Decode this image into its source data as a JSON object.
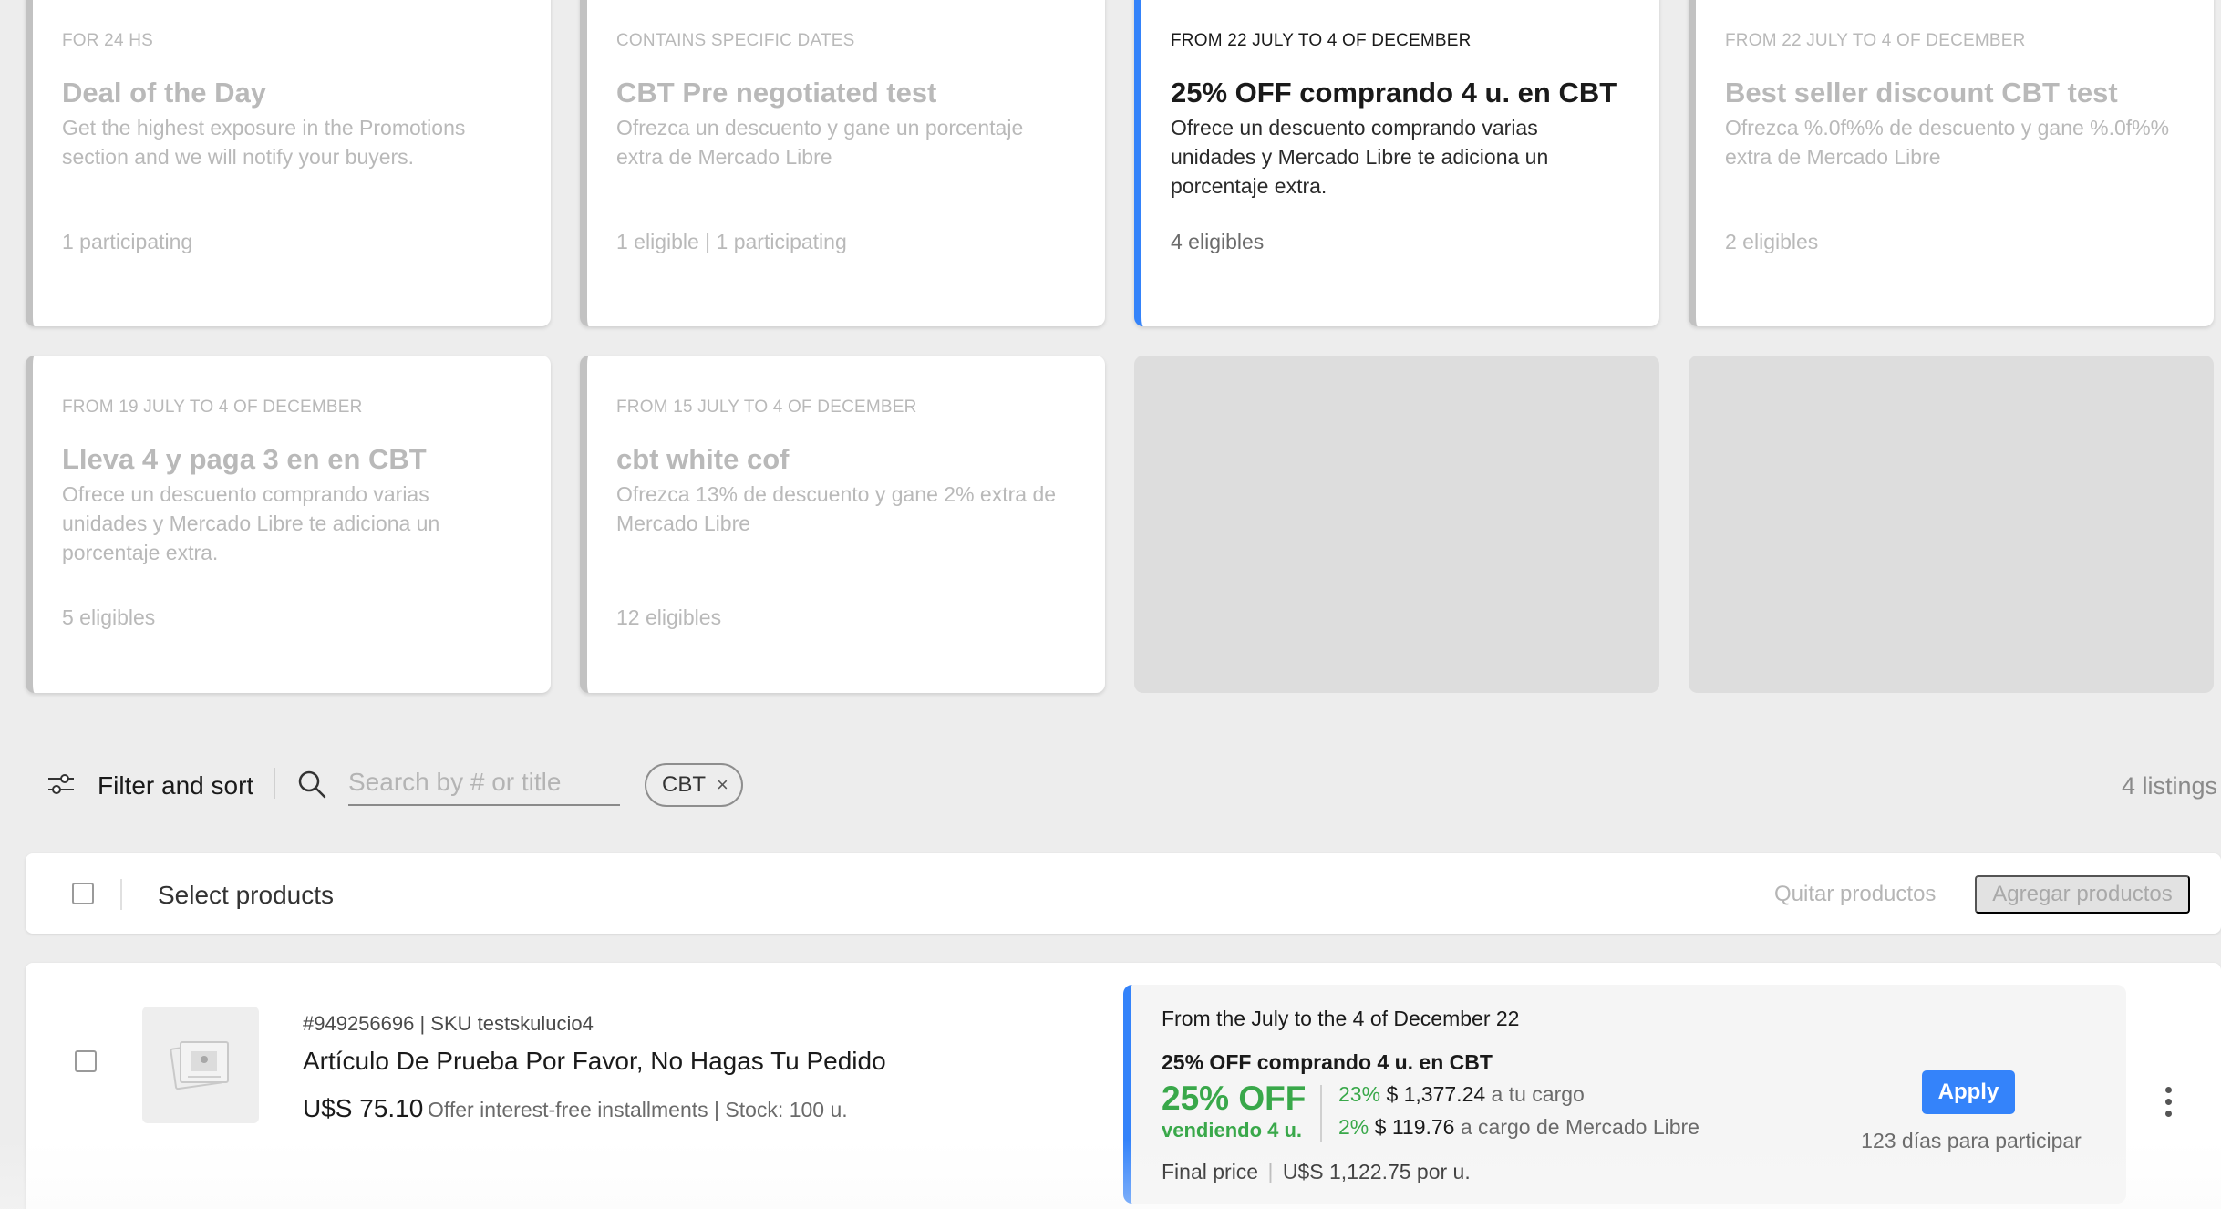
{
  "promotions": [
    {
      "date": "FOR 24 HS",
      "title": "Deal of the Day",
      "desc": "Get the highest exposure in the Promotions section and we will notify your buyers.",
      "count": "1 participating",
      "state": "disabled"
    },
    {
      "date": "CONTAINS SPECIFIC DATES",
      "title": "CBT Pre negotiated test",
      "desc": "Ofrezca un descuento y gane un porcentaje extra de Mercado Libre",
      "count": "1 eligible | 1 participating",
      "state": "disabled"
    },
    {
      "date": "FROM 22 JULY TO 4 OF DECEMBER",
      "title": "25% OFF comprando 4 u. en CBT",
      "desc": "Ofrece un descuento comprando varias unidades y Mercado Libre te adiciona un porcentaje extra.",
      "count": "4 eligibles",
      "state": "active"
    },
    {
      "date": "FROM 22 JULY TO 4 OF DECEMBER",
      "title": "Best seller discount CBT test",
      "desc": "Ofrezca %.0f%% de descuento y gane %.0f%% extra de Mercado Libre",
      "count": "2 eligibles",
      "state": "disabled"
    },
    {
      "date": "FROM 19 JULY TO 4 OF DECEMBER",
      "title": "Lleva 4 y paga 3 en en CBT",
      "desc": "Ofrece un descuento comprando varias unidades y Mercado Libre te adiciona un porcentaje extra.",
      "count": "5 eligibles",
      "state": "disabled"
    },
    {
      "date": "FROM 15 JULY TO 4 OF DECEMBER",
      "title": "cbt white cof",
      "desc": "Ofrezca 13% de descuento y gane 2% extra de Mercado Libre",
      "count": "12 eligibles",
      "state": "disabled"
    }
  ],
  "filter": {
    "label": "Filter and sort",
    "search_placeholder": "Search by # or title",
    "chip_label": "CBT",
    "chip_remove": "×",
    "listings_count": "4 listings"
  },
  "select_bar": {
    "label": "Select products",
    "remove_label": "Quitar productos",
    "add_label": "Agregar productos"
  },
  "product": {
    "meta": "#949256696 | SKU testskulucio4",
    "title": "Artículo De Prueba Por Favor, No Hagas Tu Pedido",
    "price": "U$S 75.10",
    "price_meta": "Offer interest-free installments | Stock: 100 u.",
    "promo": {
      "dates": "From the July to the 4 of December 22",
      "name": "25% OFF comprando 4 u. en CBT",
      "off": "25% OFF",
      "sub": "vendiendo 4 u.",
      "line1_pct": "23%",
      "line1_amt": "$ 1,377.24",
      "line1_who": "a tu cargo",
      "line2_pct": "2%",
      "line2_amt": "$ 119.76",
      "line2_who": "a cargo de Mercado Libre",
      "final_label": "Final price",
      "final_sep": "|",
      "final_value": "U$S 1,122.75 por u."
    },
    "apply_label": "Apply",
    "days_left": "123 días para participar"
  },
  "colors": {
    "accent": "#3483fa",
    "green": "#39a84a",
    "background": "#ededed"
  }
}
